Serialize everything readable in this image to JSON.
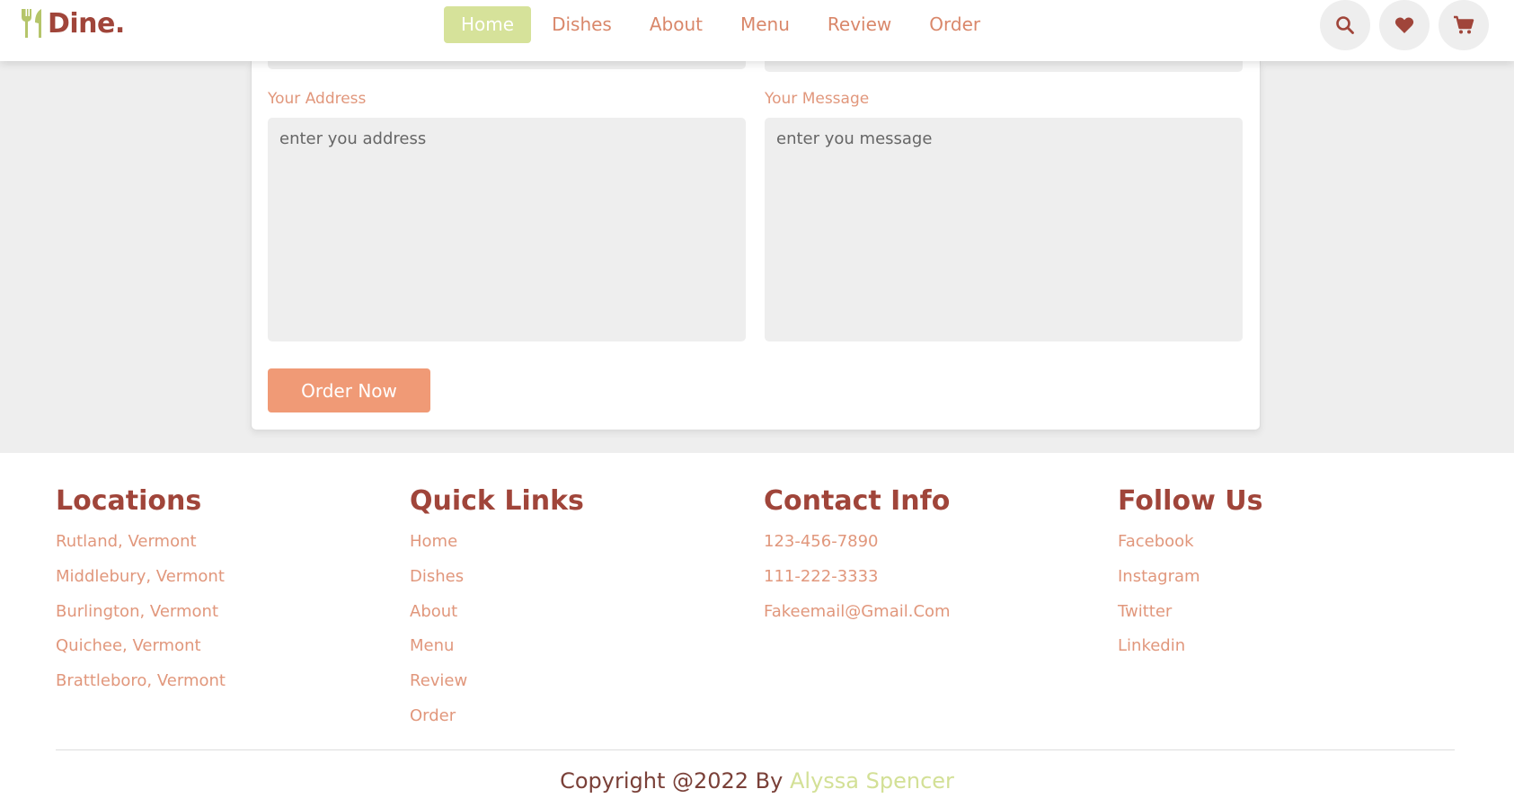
{
  "header": {
    "brand": "Dine.",
    "nav": [
      {
        "label": "Home",
        "active": true
      },
      {
        "label": "Dishes",
        "active": false
      },
      {
        "label": "About",
        "active": false
      },
      {
        "label": "Menu",
        "active": false
      },
      {
        "label": "Review",
        "active": false
      },
      {
        "label": "Order",
        "active": false
      }
    ],
    "icons": [
      "search-icon",
      "heart-icon",
      "cart-icon"
    ]
  },
  "order_form": {
    "address_label": "Your Address",
    "address_placeholder": "enter you address",
    "message_label": "Your Message",
    "message_placeholder": "enter you message",
    "submit_label": "Order Now"
  },
  "footer": {
    "locations": {
      "title": "Locations",
      "items": [
        "Rutland, Vermont",
        "Middlebury, Vermont",
        "Burlington, Vermont",
        "Quichee, Vermont",
        "Brattleboro, Vermont"
      ]
    },
    "quick_links": {
      "title": "Quick Links",
      "items": [
        "Home",
        "Dishes",
        "About",
        "Menu",
        "Review",
        "Order"
      ]
    },
    "contact": {
      "title": "Contact Info",
      "items": [
        "123-456-7890",
        "111-222-3333",
        "Fakeemail@Gmail.Com"
      ]
    },
    "follow": {
      "title": "Follow Us",
      "items": [
        "Facebook",
        "Instagram",
        "Twitter",
        "Linkedin"
      ]
    },
    "copyright_prefix": "Copyright @2022 By",
    "copyright_author": "Alyssa Spencer"
  },
  "colors": {
    "brand_dark": "#a0453a",
    "accent_peach": "#f09a76",
    "link_peach": "#e1977c",
    "accent_green": "#d6e29a",
    "panel_gray": "#eeeeee"
  }
}
